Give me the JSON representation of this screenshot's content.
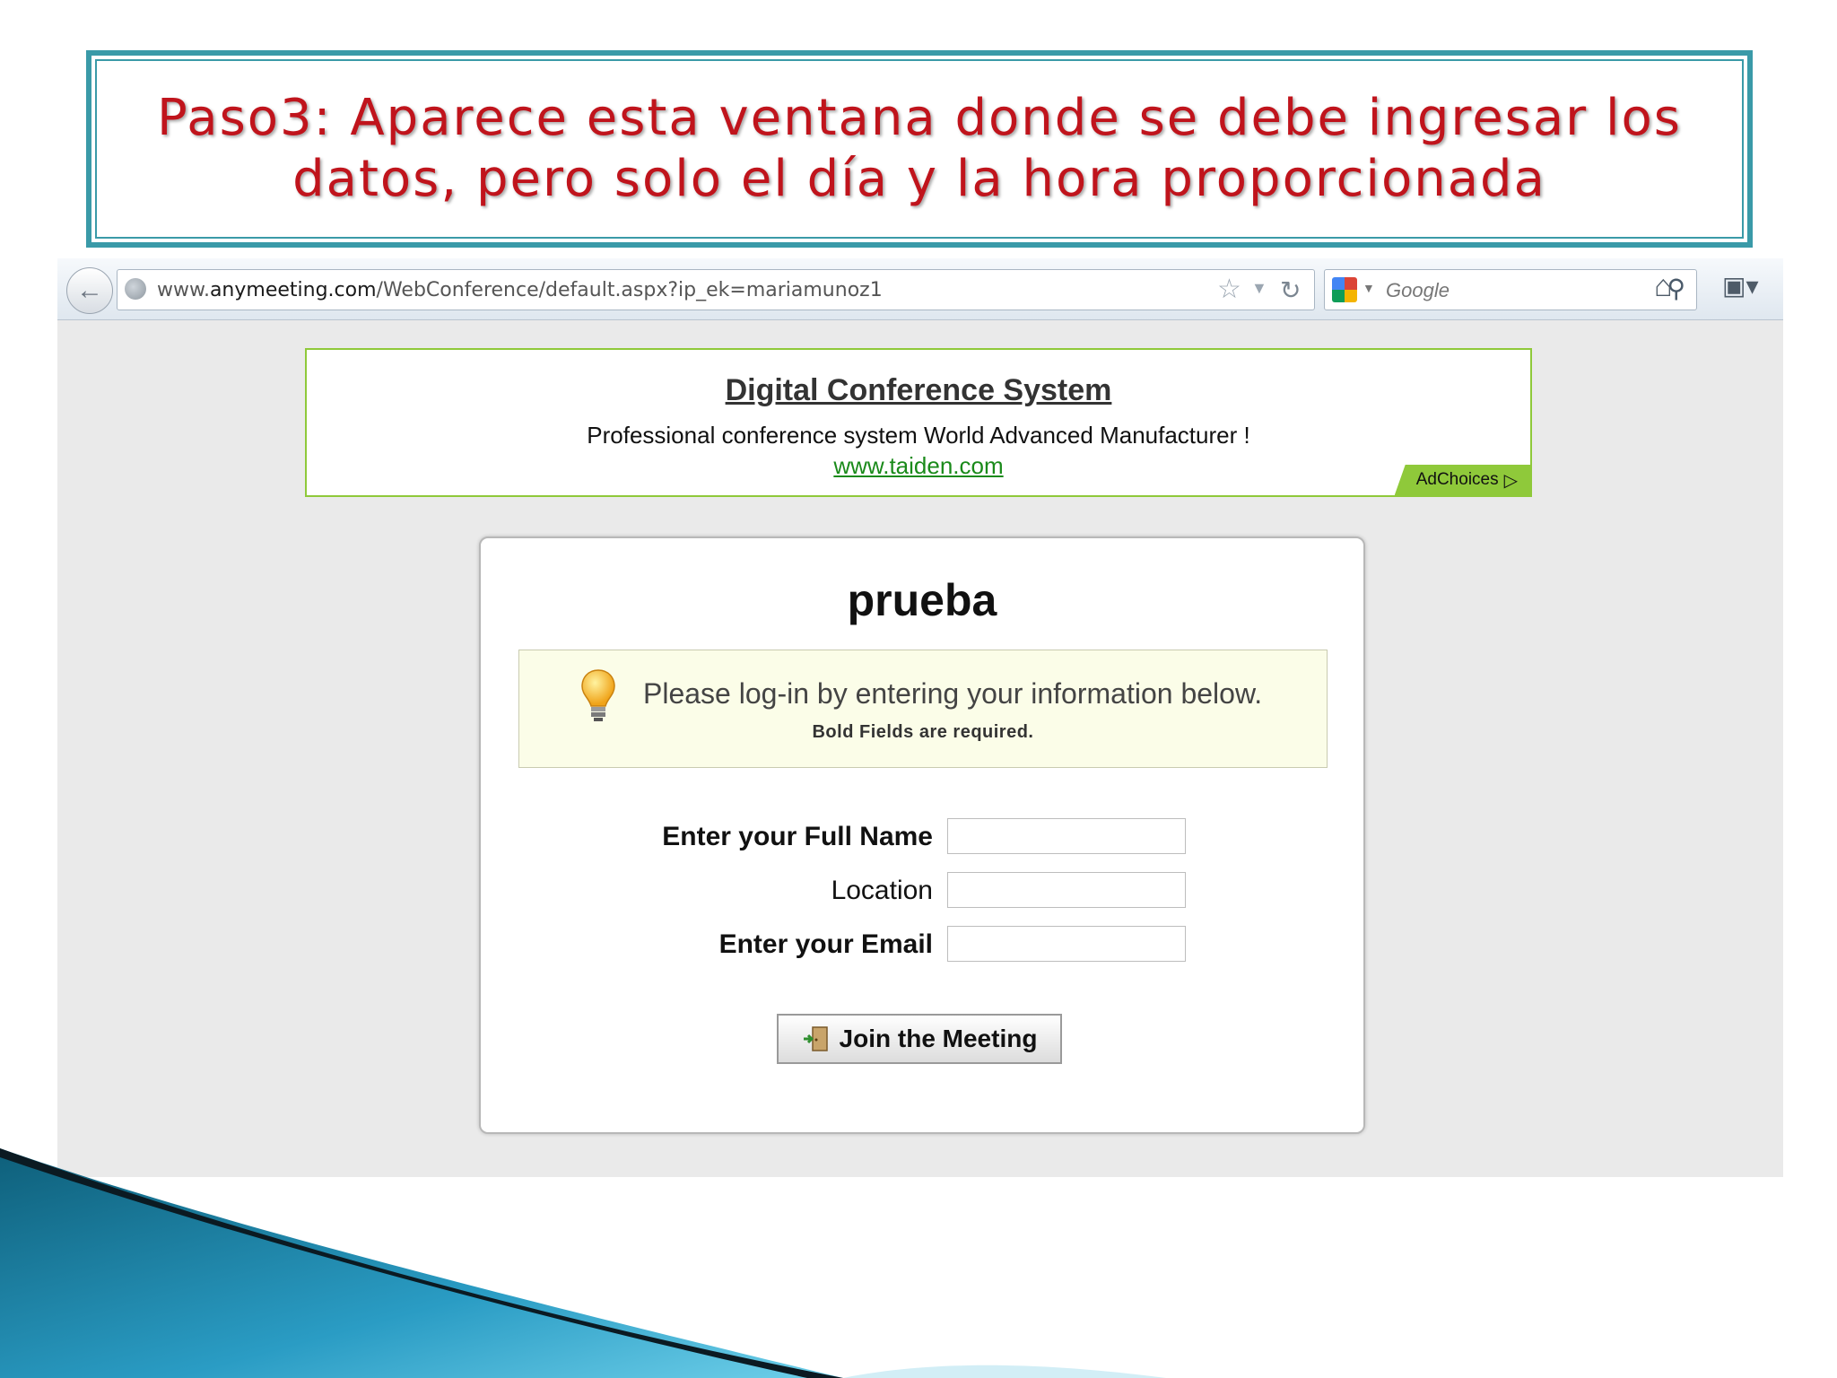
{
  "slide": {
    "title_line1": "Paso3: Aparece esta ventana donde se debe ingresar los",
    "title_line2": "datos, pero solo el día y la hora proporcionada",
    "title_color": "#c0141c",
    "frame_color": "#3a9aa8"
  },
  "browser": {
    "url_prefix": "www.",
    "url_domain": "anymeeting.com",
    "url_path": "/WebConference/default.aspx?ip_ek=mariamunoz1",
    "search_placeholder": "Google",
    "icons": [
      "back-icon",
      "globe-icon",
      "star-icon",
      "reload-icon",
      "google-icon",
      "search-icon",
      "home-icon",
      "bookmarks-icon"
    ]
  },
  "ad": {
    "title": "Digital Conference System",
    "description": "Professional conference system World Advanced Manufacturer !",
    "url": "www.taiden.com",
    "adchoices": "AdChoices",
    "accent_color": "#8fc93a"
  },
  "login": {
    "title": "prueba",
    "notice": "Please log-in by entering your information below.",
    "notice_sub": "Bold Fields are required.",
    "fields": [
      {
        "label": "Enter your Full Name",
        "value": "",
        "required": true
      },
      {
        "label": "Location",
        "value": "",
        "required": false
      },
      {
        "label": "Enter your Email",
        "value": "",
        "required": true
      }
    ],
    "join_button": "Join the Meeting"
  }
}
